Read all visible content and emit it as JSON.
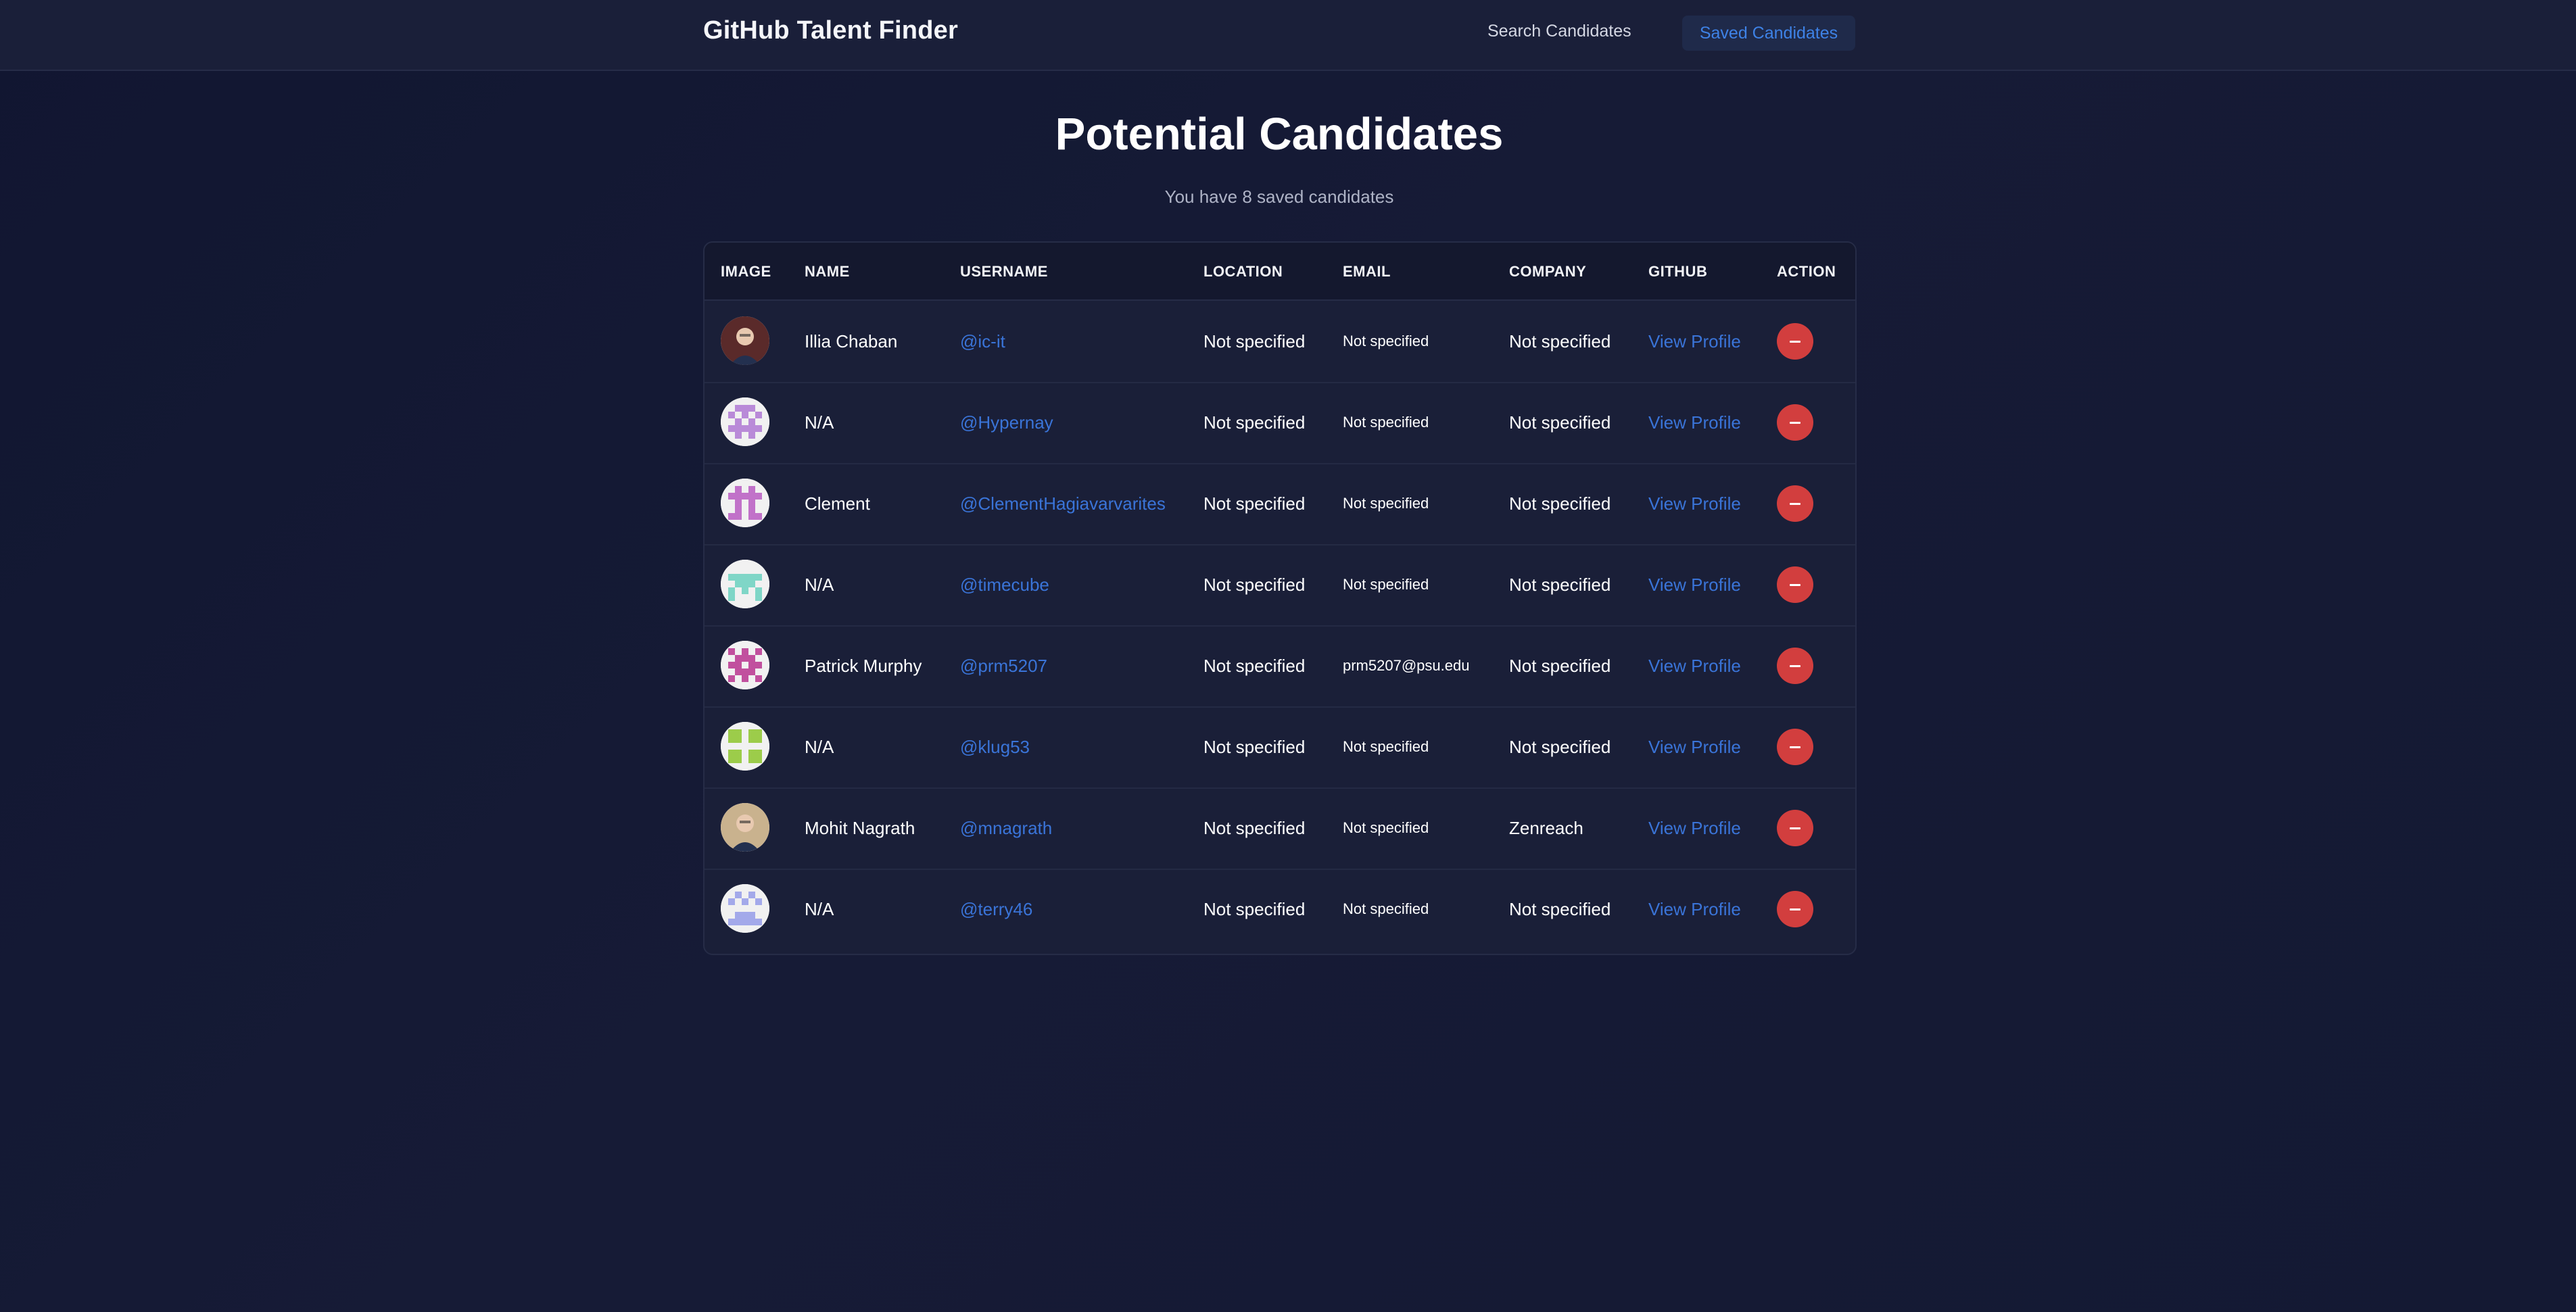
{
  "header": {
    "brand": "GitHub Talent Finder",
    "nav": {
      "search_label": "Search Candidates",
      "saved_label": "Saved Candidates"
    }
  },
  "main": {
    "title": "Potential Candidates",
    "subtitle": "You have 8 saved candidates"
  },
  "table": {
    "headers": {
      "image": "IMAGE",
      "name": "NAME",
      "username": "USERNAME",
      "location": "LOCATION",
      "email": "EMAIL",
      "company": "COMPANY",
      "github": "GITHUB",
      "action": "ACTION"
    },
    "rows": [
      {
        "name": "Illia Chaban",
        "username": "@ic-it",
        "location": "Not specified",
        "email": "Not specified",
        "company": "Not specified",
        "github": "View Profile",
        "avatar_type": "photo",
        "avatar_color": "#5a2a2a"
      },
      {
        "name": "N/A",
        "username": "@Hypernay",
        "location": "Not specified",
        "email": "Not specified",
        "company": "Not specified",
        "github": "View Profile",
        "avatar_type": "identicon",
        "avatar_color": "#b98ad8"
      },
      {
        "name": "Clement",
        "username": "@ClementHagiavarvarites",
        "location": "Not specified",
        "email": "Not specified",
        "company": "Not specified",
        "github": "View Profile",
        "avatar_type": "identicon",
        "avatar_color": "#c172c9"
      },
      {
        "name": "N/A",
        "username": "@timecube",
        "location": "Not specified",
        "email": "Not specified",
        "company": "Not specified",
        "github": "View Profile",
        "avatar_type": "identicon",
        "avatar_color": "#7fd6c7"
      },
      {
        "name": "Patrick Murphy",
        "username": "@prm5207",
        "location": "Not specified",
        "email": "prm5207@psu.edu",
        "company": "Not specified",
        "github": "View Profile",
        "avatar_type": "identicon",
        "avatar_color": "#c1509e"
      },
      {
        "name": "N/A",
        "username": "@klug53",
        "location": "Not specified",
        "email": "Not specified",
        "company": "Not specified",
        "github": "View Profile",
        "avatar_type": "identicon",
        "avatar_color": "#9ccc4a"
      },
      {
        "name": "Mohit Nagrath",
        "username": "@mnagrath",
        "location": "Not specified",
        "email": "Not specified",
        "company": "Zenreach",
        "github": "View Profile",
        "avatar_type": "photo",
        "avatar_color": "#c9b28e"
      },
      {
        "name": "N/A",
        "username": "@terry46",
        "location": "Not specified",
        "email": "Not specified",
        "company": "Not specified",
        "github": "View Profile",
        "avatar_type": "identicon",
        "avatar_color": "#a3a9ea"
      }
    ],
    "action_icon": "minus-icon"
  },
  "colors": {
    "background": "#141933",
    "header_bg": "#1a1f39",
    "link": "#3a74d8",
    "nav_active_text": "#3e82e6",
    "remove_button": "#d23e3e"
  }
}
